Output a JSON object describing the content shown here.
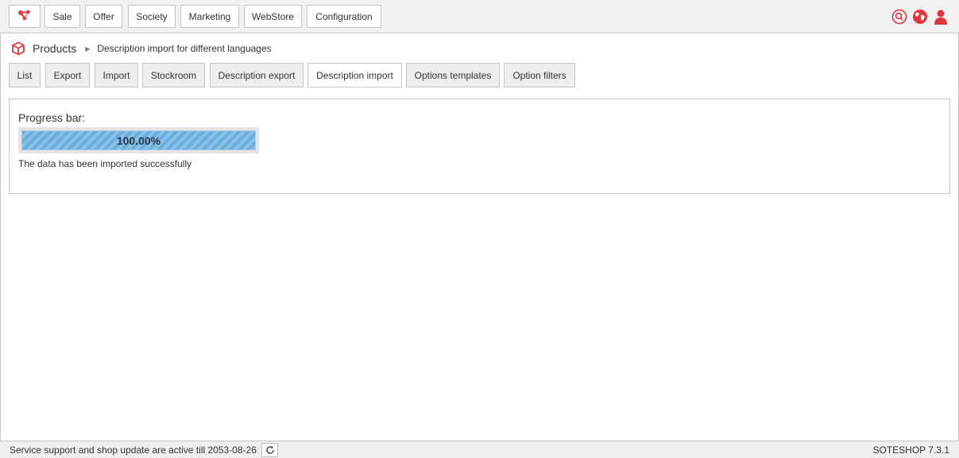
{
  "topnav": {
    "logo_icon": "share-nodes-icon",
    "items": [
      {
        "label": "Sale"
      },
      {
        "label": "Offer"
      },
      {
        "label": "Society"
      },
      {
        "label": "Marketing"
      },
      {
        "label": "WebStore"
      },
      {
        "label": "Configuration"
      }
    ],
    "right_icons": [
      "search-icon",
      "globe-icon",
      "user-icon"
    ]
  },
  "breadcrumb": {
    "icon": "cube-icon",
    "section": "Products",
    "current": "Description import for different languages"
  },
  "tabs": [
    {
      "label": "List",
      "active": false
    },
    {
      "label": "Export",
      "active": false
    },
    {
      "label": "Import",
      "active": false
    },
    {
      "label": "Stockroom",
      "active": false
    },
    {
      "label": "Description export",
      "active": false
    },
    {
      "label": "Description import",
      "active": true
    },
    {
      "label": "Options templates",
      "active": false
    },
    {
      "label": "Option filters",
      "active": false
    }
  ],
  "panel": {
    "progress_label": "Progress bar:",
    "progress_value": 1.0,
    "progress_text": "100.00%",
    "status_message": "The data has been imported successfully"
  },
  "footer": {
    "support_text": "Service support and shop update are active till 2053-08-26",
    "refresh_icon": "refresh-icon",
    "version": "SOTESHOP 7.3.1"
  },
  "colors": {
    "accent": "#e0383e",
    "progress_fill": "#6aaee0"
  }
}
